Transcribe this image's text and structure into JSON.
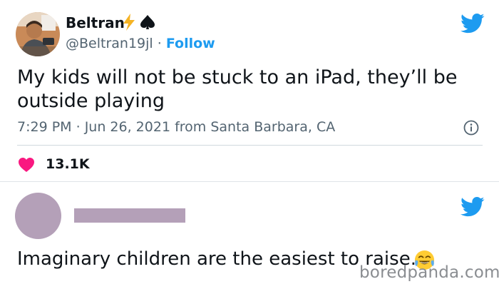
{
  "colors": {
    "twitter_blue": "#1d9bf0",
    "heart": "#f91880",
    "redacted": "#b4a0b8",
    "bolt": "#f5b324",
    "muted_text": "#536471"
  },
  "tweet": {
    "author_name": "Beltran",
    "handle": "@Beltran19jl",
    "separator": "·",
    "follow_label": "Follow",
    "text": "My kids will not be stuck to an iPad, they’ll be outside playing",
    "time": "7:29 PM",
    "date": "Jun 26, 2021",
    "location": "from Santa Barbara, CA",
    "likes": "13.1K",
    "icons": {
      "verified_emoji": "bolt-icon",
      "suit_emoji": "spade-icon",
      "brand": "twitter-bird-icon",
      "info": "info-icon",
      "like": "heart-icon"
    }
  },
  "reply": {
    "text": "Imaginary children are the easiest to raise.",
    "emoji": "tears-of-joy-emoji",
    "name_redacted": true
  },
  "watermark": "boredpanda.com"
}
